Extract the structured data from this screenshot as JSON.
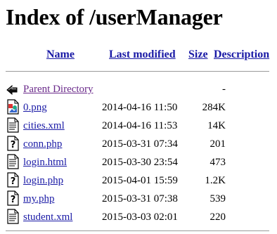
{
  "title": "Index of /userManager",
  "columns": {
    "name": "Name",
    "last_modified": "Last modified",
    "size": "Size",
    "description": "Description"
  },
  "parent": {
    "label": "Parent Directory",
    "size": "-",
    "icon": "back-arrow-icon"
  },
  "rows": [
    {
      "name": "0.png",
      "modified": "2014-04-16 11:50",
      "size": "284K",
      "icon": "image-file-icon"
    },
    {
      "name": "cities.xml",
      "modified": "2014-04-16 11:53",
      "size": "14K",
      "icon": "text-file-icon"
    },
    {
      "name": "conn.php",
      "modified": "2015-03-31 07:34",
      "size": "201",
      "icon": "unknown-file-icon"
    },
    {
      "name": "login.html",
      "modified": "2015-03-30 23:54",
      "size": "473",
      "icon": "text-file-icon"
    },
    {
      "name": "login.php",
      "modified": "2015-04-01 15:59",
      "size": "1.2K",
      "icon": "unknown-file-icon"
    },
    {
      "name": "my.php",
      "modified": "2015-03-31 07:38",
      "size": "539",
      "icon": "unknown-file-icon"
    },
    {
      "name": "student.xml",
      "modified": "2015-03-03 02:01",
      "size": "220",
      "icon": "text-file-icon"
    }
  ]
}
